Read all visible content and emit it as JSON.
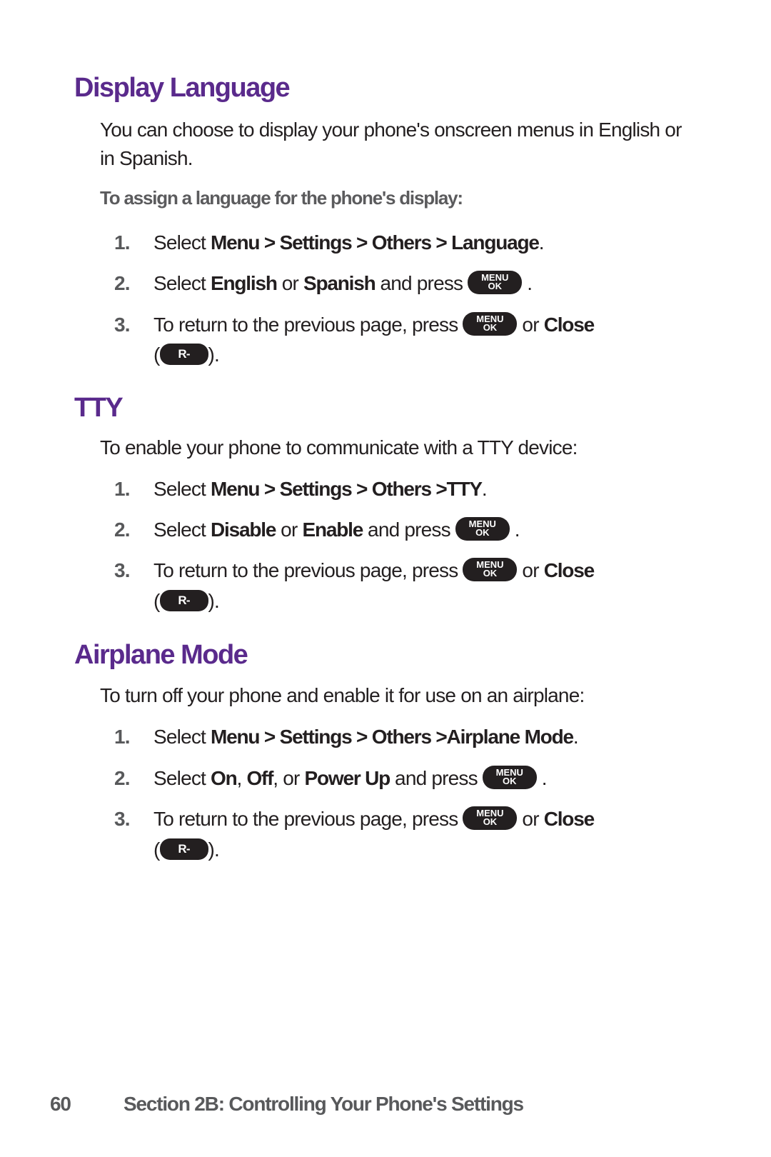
{
  "sections": [
    {
      "title": "Display Language",
      "intro": "You can choose to display your phone's onscreen menus in English or in Spanish.",
      "subheading": "To assign a language for the phone's display:",
      "steps": [
        {
          "num": "1.",
          "pre": "Select ",
          "bold1": "Menu > Settings > Others > Language",
          "post": "."
        },
        {
          "num": "2.",
          "pre": "Select ",
          "bold1": "English",
          "mid": " or ",
          "bold2": "Spanish",
          "post": " and press"
        },
        {
          "num": "3.",
          "pre": "To return to the previous page, press",
          "mid": " or ",
          "bold1": "Close"
        }
      ]
    },
    {
      "title": "TTY",
      "intro": "To enable your phone to communicate with a TTY device:",
      "steps": [
        {
          "num": "1.",
          "pre": "Select ",
          "bold1": "Menu > Settings > Others >TTY",
          "post": "."
        },
        {
          "num": "2.",
          "pre": "Select ",
          "bold1": "Disable",
          "mid": " or ",
          "bold2": "Enable",
          "post": " and press"
        },
        {
          "num": "3.",
          "pre": "To return to the previous page, press",
          "mid": " or ",
          "bold1": "Close"
        }
      ]
    },
    {
      "title": "Airplane Mode",
      "intro": "To turn off your phone and enable it for use on an airplane:",
      "steps": [
        {
          "num": "1.",
          "pre": "Select ",
          "bold1": "Menu > Settings > Others >Airplane Mode",
          "post": "."
        },
        {
          "num": "2.",
          "pre": "Select ",
          "bold1": "On",
          "mid": ", ",
          "bold2": "Off",
          "mid2": ", or ",
          "bold3": "Power Up",
          "post": " and press"
        },
        {
          "num": "3.",
          "pre": "To return to the previous page, press",
          "mid": " or ",
          "bold1": "Close"
        }
      ]
    }
  ],
  "keys": {
    "menu_top": "MENU",
    "menu_bottom": "OK",
    "softkey": "R-Softkey"
  },
  "punct": {
    "open": "(",
    "close": ").",
    "dot": "."
  },
  "footer": {
    "page_number": "60",
    "section": "Section 2B: Controlling Your Phone's Settings"
  },
  "colors": {
    "heading": "#5a2a8c",
    "body": "#231f20",
    "muted": "#58595b"
  }
}
